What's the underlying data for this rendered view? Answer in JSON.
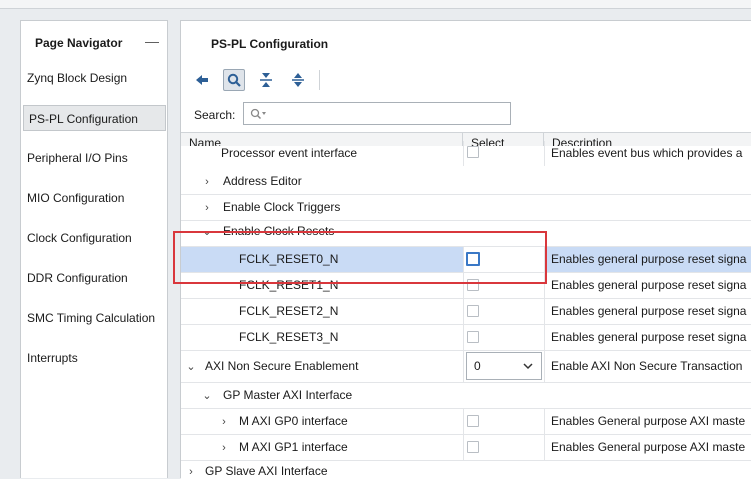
{
  "navigator": {
    "title": "Page Navigator",
    "collapse_symbol": "—",
    "items": [
      {
        "label": "Zynq Block Design"
      },
      {
        "label": "PS-PL Configuration",
        "selected": true
      },
      {
        "label": "Peripheral I/O Pins"
      },
      {
        "label": "MIO Configuration"
      },
      {
        "label": "Clock Configuration"
      },
      {
        "label": "DDR Configuration"
      },
      {
        "label": "SMC Timing Calculation"
      },
      {
        "label": "Interrupts"
      }
    ]
  },
  "main": {
    "title": "PS-PL Configuration",
    "toolbar": [
      "back-icon",
      "search-icon",
      "collapse-all-icon",
      "expand-all-icon"
    ],
    "search": {
      "label": "Search:",
      "placeholder": "Q-"
    },
    "columns": {
      "name": "Name",
      "select": "Select",
      "description": "Description"
    },
    "rows": [
      {
        "name": "Processor event interface",
        "chevron": "",
        "description": "Enables event bus which provides a"
      },
      {
        "name": "Address Editor",
        "chevron": "›",
        "description": ""
      },
      {
        "name": "Enable Clock Triggers",
        "chevron": "›",
        "description": ""
      },
      {
        "name": "Enable Clock Resets",
        "chevron": "⌄",
        "description": ""
      },
      {
        "name": "FCLK_RESET0_N",
        "chevron": "",
        "description": "Enables general purpose reset signa",
        "selected": true
      },
      {
        "name": "FCLK_RESET1_N",
        "chevron": "",
        "description": "Enables general purpose reset signa"
      },
      {
        "name": "FCLK_RESET2_N",
        "chevron": "",
        "description": "Enables general purpose reset signa"
      },
      {
        "name": "FCLK_RESET3_N",
        "chevron": "",
        "description": "Enables general purpose reset signa"
      },
      {
        "name": "AXI Non Secure Enablement",
        "chevron": "⌄",
        "select_value": "0",
        "description": "Enable AXI Non Secure Transaction"
      },
      {
        "name": "GP Master AXI Interface",
        "chevron": "⌄",
        "description": ""
      },
      {
        "name": "M AXI GP0 interface",
        "chevron": "›",
        "description": "Enables General purpose AXI maste"
      },
      {
        "name": "M AXI GP1 interface",
        "chevron": "›",
        "description": "Enables General purpose AXI maste"
      },
      {
        "name": "GP Slave AXI Interface",
        "chevron": "›",
        "description": ""
      }
    ]
  },
  "colors": {
    "selection": "#c9dbf5",
    "highlight_box": "#d9373c",
    "checkbox_focus": "#3a78c6"
  }
}
